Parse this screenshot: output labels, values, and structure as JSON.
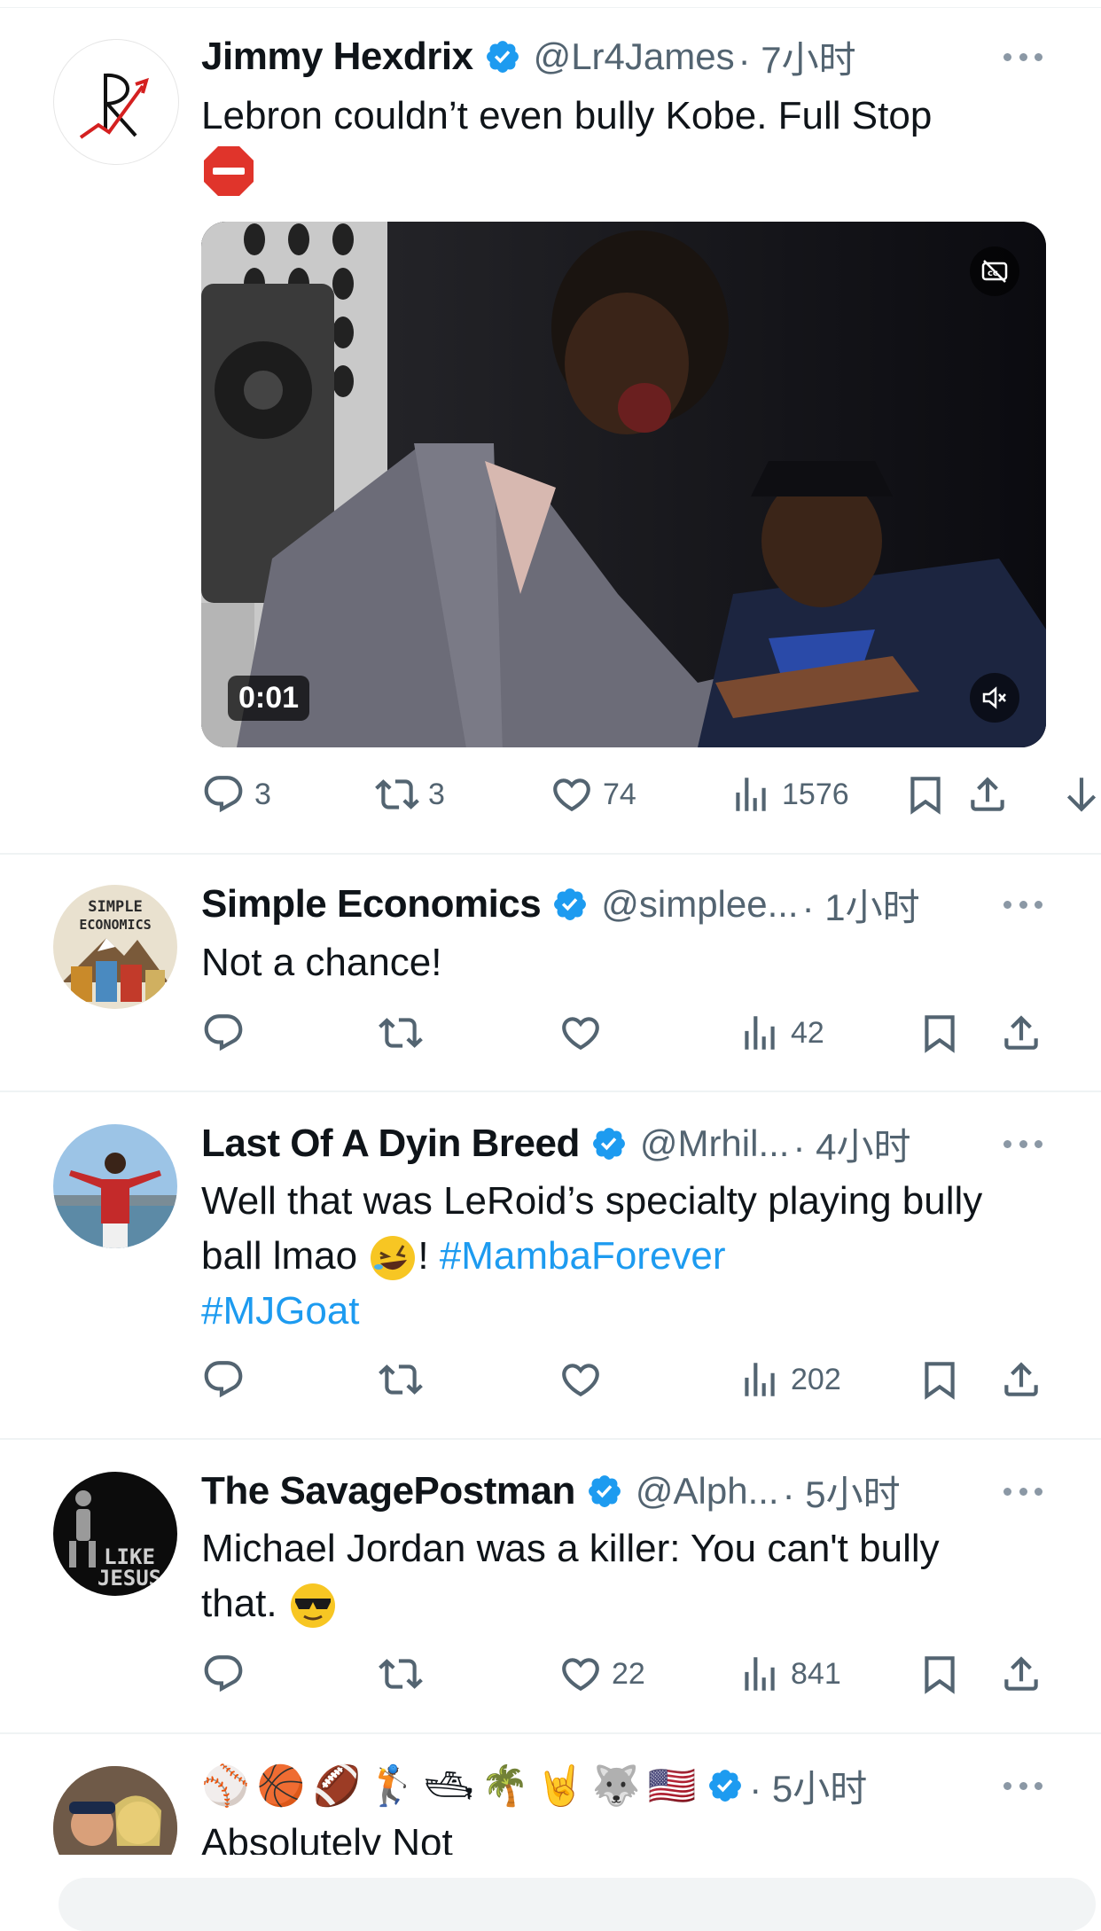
{
  "tweets": [
    {
      "name": "Jimmy Hexdrix",
      "handle": "@Lr4James",
      "time": "· 7小时",
      "text": "Lebron couldn’t even bully Kobe. Full Stop",
      "video_duration": "0:01",
      "stats": {
        "replies": "3",
        "reposts": "3",
        "likes": "74",
        "views": "1576"
      }
    },
    {
      "name": "Simple Economics",
      "handle": "@simplee...",
      "time": "· 1小时",
      "text": "Not a chance!",
      "avatar_text": [
        "SIMPLE",
        "ECONOMICS"
      ],
      "stats": {
        "replies": "",
        "reposts": "",
        "likes": "",
        "views": "42"
      }
    },
    {
      "name": "Last Of A Dyin Breed",
      "handle": "@Mrhil...",
      "time": "· 4小时",
      "text_parts": [
        "Well that was LeRoid’s specialty playing bully ball lmao ",
        "! "
      ],
      "hashtags": [
        "#MambaForever",
        "#MJGoat"
      ],
      "stats": {
        "replies": "",
        "reposts": "",
        "likes": "",
        "views": "202"
      }
    },
    {
      "name": "The SavagePostman",
      "handle": "@Alph...",
      "time": "· 5小时",
      "text": "Michael Jordan was a killer: You can't bully that.",
      "avatar_text": [
        "LIKE",
        "JESUS"
      ],
      "stats": {
        "replies": "",
        "reposts": "",
        "likes": "22",
        "views": "841"
      }
    },
    {
      "name_emoji": [
        "⚾",
        "🏀",
        "🏈",
        "🏌",
        "🛥",
        "🌴",
        "🤘",
        "🐺",
        "🇺🇸"
      ],
      "time": "· 5小时",
      "text": "Absolutely Not"
    }
  ],
  "colors": {
    "accent": "#1d9bf0",
    "muted": "#536471",
    "separator": "#eff3f4",
    "stop_sign": "#e0342b"
  },
  "icons": [
    "reply-icon",
    "repost-icon",
    "like-icon",
    "views-icon",
    "bookmark-icon",
    "share-icon",
    "verified-icon",
    "more-icon",
    "captions-icon",
    "mute-icon",
    "scroll-down-icon"
  ]
}
